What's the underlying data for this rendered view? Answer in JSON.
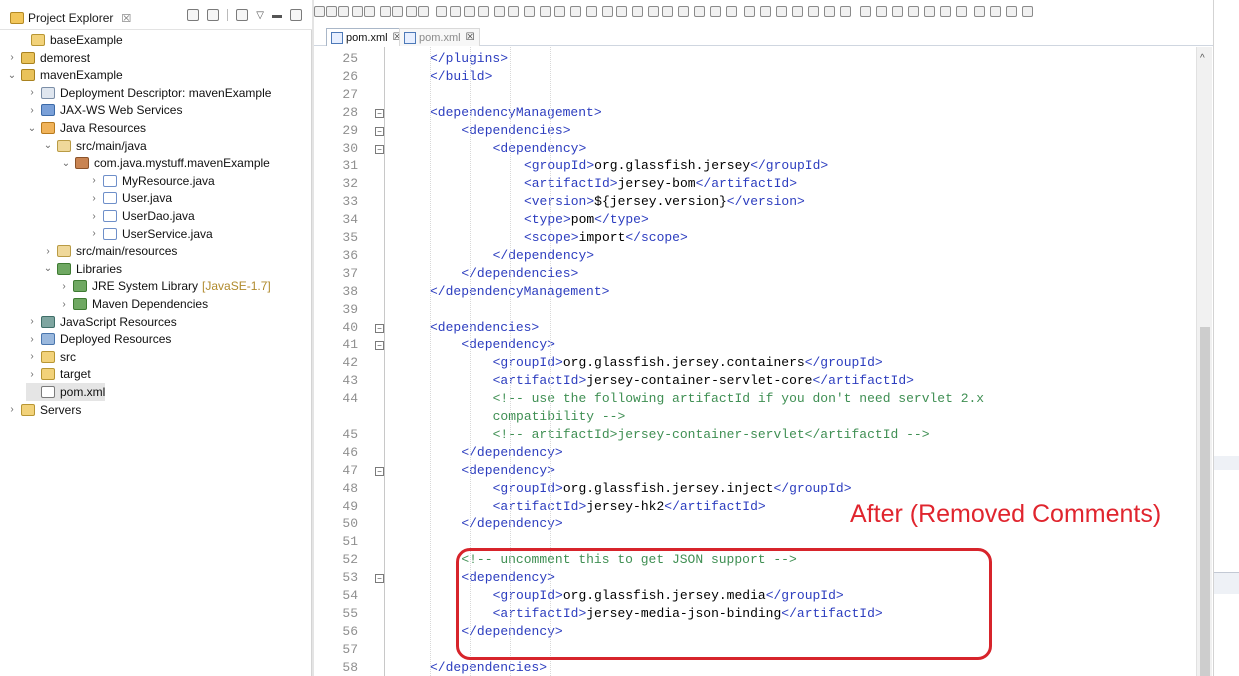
{
  "explorer": {
    "title": "Project Explorer",
    "close_glyph": "☒",
    "items": [
      {
        "label": "baseExample",
        "twist": "",
        "icon": "folder-icon"
      },
      {
        "label": "demorest",
        "twist": "›",
        "icon": "project-icon"
      },
      {
        "label": "mavenExample",
        "twist": "⌄",
        "icon": "project-icon"
      },
      {
        "label": "Deployment Descriptor: mavenExample",
        "twist": "›",
        "icon": "deployment-descriptor-icon"
      },
      {
        "label": "JAX-WS Web Services",
        "twist": "›",
        "icon": "web-services-icon"
      },
      {
        "label": "Java Resources",
        "twist": "⌄",
        "icon": "java-resources-icon"
      },
      {
        "label": "src/main/java",
        "twist": "⌄",
        "icon": "source-folder-icon"
      },
      {
        "label": "com.java.mystuff.mavenExample",
        "twist": "⌄",
        "icon": "package-icon"
      },
      {
        "label": "MyResource.java",
        "twist": "›",
        "icon": "java-file-icon"
      },
      {
        "label": "User.java",
        "twist": "›",
        "icon": "java-file-icon"
      },
      {
        "label": "UserDao.java",
        "twist": "›",
        "icon": "java-file-icon"
      },
      {
        "label": "UserService.java",
        "twist": "›",
        "icon": "java-file-icon"
      },
      {
        "label": "src/main/resources",
        "twist": "›",
        "icon": "source-folder-icon"
      },
      {
        "label": "Libraries",
        "twist": "⌄",
        "icon": "library-icon"
      },
      {
        "label": "JRE System Library",
        "decor": "[JavaSE-1.7]",
        "twist": "›",
        "icon": "library-icon"
      },
      {
        "label": "Maven Dependencies",
        "twist": "›",
        "icon": "library-icon"
      },
      {
        "label": "JavaScript Resources",
        "twist": "›",
        "icon": "javascript-resources-icon"
      },
      {
        "label": "Deployed Resources",
        "twist": "›",
        "icon": "deployed-resources-icon"
      },
      {
        "label": "src",
        "twist": "›",
        "icon": "folder-icon"
      },
      {
        "label": "target",
        "twist": "›",
        "icon": "folder-icon"
      },
      {
        "label": "pom.xml",
        "twist": "",
        "icon": "pom-file-icon"
      },
      {
        "label": "Servers",
        "twist": "›",
        "icon": "folder-icon"
      }
    ]
  },
  "editor": {
    "tabs": [
      {
        "label": "pom.xml",
        "close": "☒",
        "active": true
      },
      {
        "label": "pom.xml",
        "close": "☒",
        "active": false
      }
    ],
    "lines": [
      {
        "n": "25",
        "code": [
          [
            "tag",
            "</plugins>"
          ]
        ]
      },
      {
        "n": "26",
        "code": [
          [
            "tag",
            "</build>"
          ]
        ]
      },
      {
        "n": "27",
        "code": []
      },
      {
        "n": "28",
        "code": [
          [
            "tag",
            "<dependencyManagement>"
          ]
        ]
      },
      {
        "n": "29",
        "code": [
          [
            "tag",
            "<dependencies>"
          ]
        ]
      },
      {
        "n": "30",
        "code": [
          [
            "tag",
            "<dependency>"
          ]
        ]
      },
      {
        "n": "31",
        "code": [
          [
            "tag",
            "<groupId>"
          ],
          [
            "txt",
            "org.glassfish.jersey"
          ],
          [
            "tag",
            "</groupId>"
          ]
        ]
      },
      {
        "n": "32",
        "code": [
          [
            "tag",
            "<artifactId>"
          ],
          [
            "txt",
            "jersey-bom"
          ],
          [
            "tag",
            "</artifactId>"
          ]
        ]
      },
      {
        "n": "33",
        "code": [
          [
            "tag",
            "<version>"
          ],
          [
            "txt",
            "${jersey.version}"
          ],
          [
            "tag",
            "</version>"
          ]
        ]
      },
      {
        "n": "34",
        "code": [
          [
            "tag",
            "<type>"
          ],
          [
            "txt",
            "pom"
          ],
          [
            "tag",
            "</type>"
          ]
        ]
      },
      {
        "n": "35",
        "code": [
          [
            "tag",
            "<scope>"
          ],
          [
            "txt",
            "import"
          ],
          [
            "tag",
            "</scope>"
          ]
        ]
      },
      {
        "n": "36",
        "code": [
          [
            "tag",
            "</dependency>"
          ]
        ]
      },
      {
        "n": "37",
        "code": [
          [
            "tag",
            "</dependencies>"
          ]
        ]
      },
      {
        "n": "38",
        "code": [
          [
            "tag",
            "</dependencyManagement>"
          ]
        ]
      },
      {
        "n": "39",
        "code": []
      },
      {
        "n": "40",
        "code": [
          [
            "tag",
            "<dependencies>"
          ]
        ]
      },
      {
        "n": "41",
        "code": [
          [
            "tag",
            "<dependency>"
          ]
        ]
      },
      {
        "n": "42",
        "code": [
          [
            "tag",
            "<groupId>"
          ],
          [
            "txt",
            "org.glassfish.jersey.containers"
          ],
          [
            "tag",
            "</groupId>"
          ]
        ]
      },
      {
        "n": "43",
        "code": [
          [
            "tag",
            "<artifactId>"
          ],
          [
            "txt",
            "jersey-container-servlet-core"
          ],
          [
            "tag",
            "</artifactId>"
          ]
        ]
      },
      {
        "n": "44",
        "code": [
          [
            "cmt",
            "<!-- use the following artifactId if you don't need servlet 2.x"
          ]
        ]
      },
      {
        "n": "",
        "code": [
          [
            "cmt",
            "compatibility -->"
          ]
        ]
      },
      {
        "n": "45",
        "code": [
          [
            "cmt",
            "<!-- artifactId>jersey-container-servlet</artifactId -->"
          ]
        ]
      },
      {
        "n": "46",
        "code": [
          [
            "tag",
            "</dependency>"
          ]
        ]
      },
      {
        "n": "47",
        "code": [
          [
            "tag",
            "<dependency>"
          ]
        ]
      },
      {
        "n": "48",
        "code": [
          [
            "tag",
            "<groupId>"
          ],
          [
            "txt",
            "org.glassfish.jersey.inject"
          ],
          [
            "tag",
            "</groupId>"
          ]
        ]
      },
      {
        "n": "49",
        "code": [
          [
            "tag",
            "<artifactId>"
          ],
          [
            "txt",
            "jersey-hk2"
          ],
          [
            "tag",
            "</artifactId>"
          ]
        ]
      },
      {
        "n": "50",
        "code": [
          [
            "tag",
            "</dependency>"
          ]
        ]
      },
      {
        "n": "51",
        "code": []
      },
      {
        "n": "52",
        "code": [
          [
            "cmt",
            "<!-- uncomment this to get JSON support -->"
          ]
        ]
      },
      {
        "n": "53",
        "code": [
          [
            "tag",
            "<dependency>"
          ]
        ]
      },
      {
        "n": "54",
        "code": [
          [
            "tag",
            "<groupId>"
          ],
          [
            "txt",
            "org.glassfish.jersey.media"
          ],
          [
            "tag",
            "</groupId>"
          ]
        ]
      },
      {
        "n": "55",
        "code": [
          [
            "tag",
            "<artifactId>"
          ],
          [
            "txt",
            "jersey-media-json-binding"
          ],
          [
            "tag",
            "</artifactId>"
          ]
        ]
      },
      {
        "n": "56",
        "code": [
          [
            "tag",
            "</dependency>"
          ]
        ]
      },
      {
        "n": "57",
        "code": []
      },
      {
        "n": "58",
        "code": [
          [
            "tag",
            "</dependencies>"
          ]
        ]
      }
    ]
  },
  "annotation": {
    "text": "After (Removed Comments)",
    "color": "#e0252e"
  }
}
